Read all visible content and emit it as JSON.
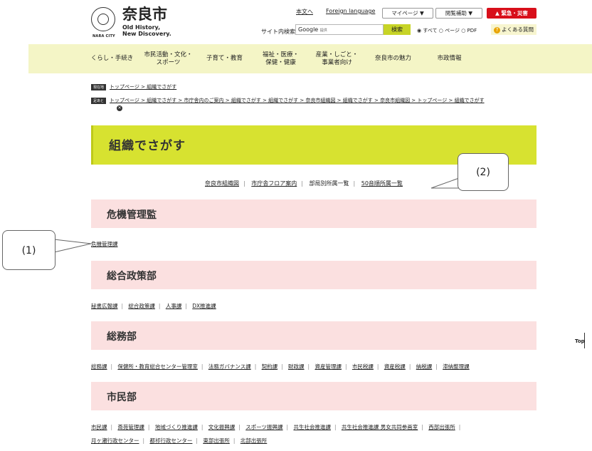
{
  "header": {
    "logo_jp": "奈良市",
    "logo_en_line1": "Old History,",
    "logo_en_line2": "New Discovery.",
    "logo_small": "NARA CITY",
    "link_main": "本文へ",
    "link_foreign": "Foreign language",
    "mypage": "マイページ ▼",
    "accessibility": "閲覧補助 ▼",
    "emergency": "▲ 緊急・災害",
    "search_label": "サイト内検索",
    "search_value": "Google",
    "search_value_small": "提供",
    "search_button": "検索",
    "radio_options": "◉ すべて ○ ページ ○ PDF",
    "faq": "よくある質問",
    "faq_icon": "?"
  },
  "nav": [
    {
      "label": "くらし・手続き"
    },
    {
      "label": "市民活動・文化・\nスポーツ"
    },
    {
      "label": "子育て・教育"
    },
    {
      "label": "福祉・医療・\n保健・健康"
    },
    {
      "label": "産業・しごと・\n事業者向け"
    },
    {
      "label": "奈良市の魅力"
    },
    {
      "label": "市政情報"
    }
  ],
  "breadcrumb": {
    "current_tag": "現在地",
    "current": "トップページ > 組織でさがす",
    "history_tag": "足あと",
    "history": "トップページ > 組織でさがす > 市庁舎内のご案内 > 組織でさがす > 組織でさがす > 奈良市組織図 > 組織でさがす > 奈良市組織図 > トップページ > 組織でさがす",
    "close": "✕"
  },
  "page_title": "組織でさがす",
  "sublinks": [
    "奈良市組織図",
    "市庁舎フロア案内",
    "部局別所属一覧",
    "50音順所属一覧"
  ],
  "callouts": {
    "one": "(1)",
    "two": "(2)"
  },
  "sections": [
    {
      "title": "危機管理監",
      "links": [
        "危機管理課"
      ]
    },
    {
      "title": "総合政策部",
      "links": [
        "秘書広報課",
        "総合政策課",
        "人事課",
        "DX推進課"
      ]
    },
    {
      "title": "総務部",
      "links": [
        "総務課",
        "保健所・教育総合センター管理室",
        "法務ガバナンス課",
        "契約課",
        "財政課",
        "資産管理課",
        "市民税課",
        "資産税課",
        "納税課",
        "滞納整理課"
      ]
    },
    {
      "title": "市民部",
      "links": [
        "市民課",
        "斎苑管理課",
        "地域づくり推進課",
        "文化振興課",
        "スポーツ振興課",
        "共生社会推進課",
        "共生社会推進課 男女共同参画室",
        "西部出張所"
      ],
      "links2": [
        "月ヶ瀬行政センター",
        "都祁行政センター",
        "東部出張所",
        "北部出張所"
      ]
    }
  ],
  "top_button": "Top"
}
